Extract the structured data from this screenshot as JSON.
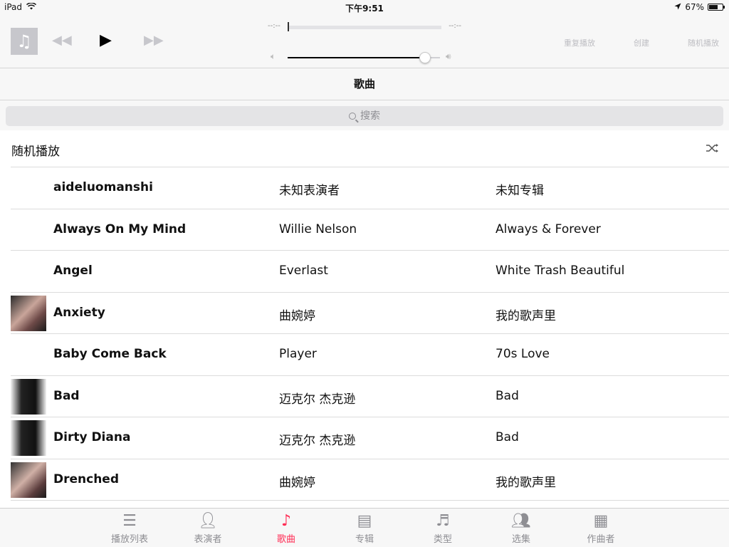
{
  "status": {
    "device": "iPad",
    "time": "下午9:51",
    "battery_text": "67%",
    "battery_level": 0.67
  },
  "player": {
    "elapsed": "--:--",
    "remaining": "--:--",
    "progress": 0.0,
    "volume": 0.9,
    "repeat_label": "重复播放",
    "create_label": "创建",
    "shuffle_label": "随机播放"
  },
  "nav": {
    "title": "歌曲"
  },
  "search": {
    "placeholder": "搜索"
  },
  "shuffle_row": {
    "label": "随机播放"
  },
  "songs": [
    {
      "title": "aideluomanshi",
      "artist": "未知表演者",
      "album": "未知专辑",
      "art": "none"
    },
    {
      "title": "Always On My Mind",
      "artist": "Willie Nelson",
      "album": "Always & Forever",
      "art": "none"
    },
    {
      "title": "Angel",
      "artist": "Everlast",
      "album": "White Trash Beautiful",
      "art": "none"
    },
    {
      "title": "Anxiety",
      "artist": "曲婉婷",
      "album": "我的歌声里",
      "art": "anxiety"
    },
    {
      "title": "Baby Come Back",
      "artist": "Player",
      "album": "70s Love",
      "art": "none"
    },
    {
      "title": "Bad",
      "artist": "迈克尔 杰克逊",
      "album": "Bad",
      "art": "bad"
    },
    {
      "title": "Dirty Diana",
      "artist": "迈克尔 杰克逊",
      "album": "Bad",
      "art": "bad"
    },
    {
      "title": "Drenched",
      "artist": "曲婉婷",
      "album": "我的歌声里",
      "art": "drench"
    }
  ],
  "tabs": [
    {
      "label": "播放列表",
      "icon": "playlist-icon",
      "active": false
    },
    {
      "label": "表演者",
      "icon": "artist-icon",
      "active": false
    },
    {
      "label": "歌曲",
      "icon": "music-note-icon",
      "active": true
    },
    {
      "label": "专辑",
      "icon": "album-icon",
      "active": false
    },
    {
      "label": "类型",
      "icon": "genre-icon",
      "active": false
    },
    {
      "label": "选集",
      "icon": "compilation-icon",
      "active": false
    },
    {
      "label": "作曲者",
      "icon": "composer-icon",
      "active": false
    }
  ],
  "colors": {
    "accent": "#ff2d55",
    "inactive": "#8e8e93"
  }
}
